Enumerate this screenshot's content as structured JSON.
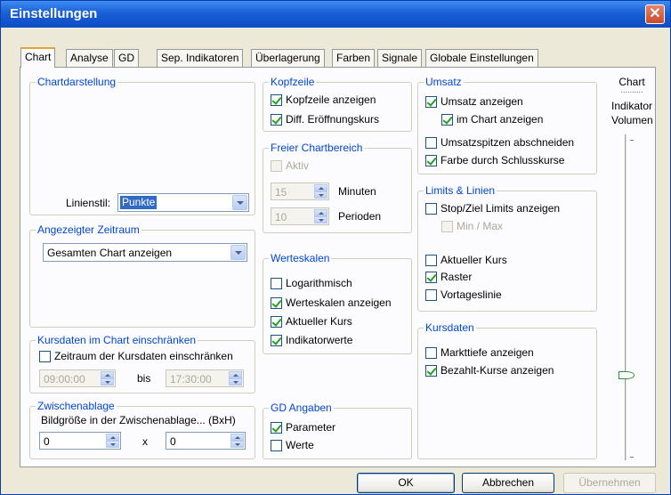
{
  "window": {
    "title": "Einstellungen"
  },
  "tabs": [
    "Chart",
    "Analyse",
    "GD",
    "Sep. Indikatoren",
    "Überlagerung",
    "Farben",
    "Signale",
    "Globale Einstellungen"
  ],
  "chartdarstellung": {
    "legend": "Chartdarstellung",
    "linienstil_label": "Linienstil:",
    "linienstil_value": "Punkte"
  },
  "zeitraum": {
    "legend": "Angezeigter Zeitraum",
    "value": "Gesamten Chart anzeigen"
  },
  "kursdaten_einschraenken": {
    "legend": "Kursdaten im Chart einschränken",
    "checkbox": "Zeitraum der Kursdaten einschränken",
    "from": "09:00:00",
    "bis": "bis",
    "to": "17:30:00"
  },
  "zwischenablage": {
    "legend": "Zwischenablage",
    "label": "Bildgröße in der Zwischenablage... (BxH)",
    "width": "0",
    "x": "x",
    "height": "0"
  },
  "kopfzeile": {
    "legend": "Kopfzeile",
    "items": [
      "Kopfzeile anzeigen",
      "Diff. Eröffnungskurs"
    ]
  },
  "freier_chartbereich": {
    "legend": "Freier Chartbereich",
    "aktiv": "Aktiv",
    "minuten_value": "15",
    "minuten_label": "Minuten",
    "perioden_value": "10",
    "perioden_label": "Perioden"
  },
  "werteskalen": {
    "legend": "Werteskalen",
    "items": [
      "Logarithmisch",
      "Werteskalen anzeigen",
      "Aktueller Kurs",
      "Indikatorwerte"
    ]
  },
  "gd_angaben": {
    "legend": "GD Angaben",
    "items": [
      "Parameter",
      "Werte"
    ]
  },
  "umsatz": {
    "legend": "Umsatz",
    "items": [
      "Umsatz anzeigen",
      "im Chart anzeigen",
      "Umsatzspitzen abschneiden",
      "Farbe durch Schlusskurse"
    ]
  },
  "limits": {
    "legend": "Limits & Linien",
    "items": [
      "Stop/Ziel Limits anzeigen",
      "Min / Max",
      "Aktueller Kurs",
      "Raster",
      "Vortageslinie"
    ]
  },
  "kursdaten": {
    "legend": "Kursdaten",
    "items": [
      "Markttiefe anzeigen",
      "Bezahlt-Kurse anzeigen"
    ]
  },
  "slider": {
    "top": "Chart",
    "dots": "..........",
    "mid1": "Indikator",
    "mid2": "Volumen"
  },
  "buttons": {
    "ok": "OK",
    "abbrechen": "Abbrechen",
    "uebernehmen": "Übernehmen"
  }
}
